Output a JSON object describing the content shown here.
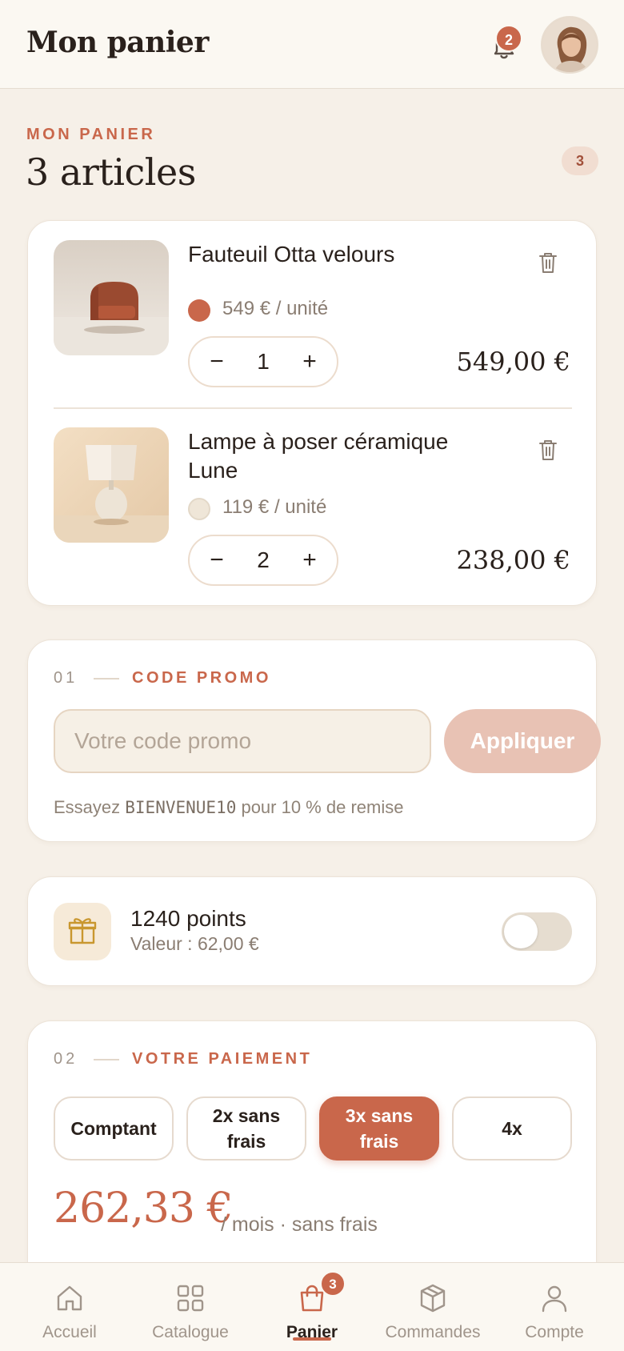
{
  "header": {
    "title": "Mon panier",
    "notifications_count": "2"
  },
  "summary": {
    "eyebrow": "MON PANIER",
    "title": "3 articles",
    "badge": "3"
  },
  "cart": {
    "items": [
      {
        "name": "Fauteuil Otta velours",
        "unit_price": "549 € / unité",
        "quantity": "1",
        "line_total": "549,00 €",
        "swatch_color": "#c9674b",
        "minus": "−",
        "plus": "+"
      },
      {
        "name": "Lampe à poser céramique Lune",
        "unit_price": "119 € / unité",
        "quantity": "2",
        "line_total": "238,00 €",
        "swatch_color": "#efe6d8",
        "minus": "−",
        "plus": "+"
      }
    ]
  },
  "promo": {
    "number": "01",
    "label": "CODE PROMO",
    "placeholder": "Votre code promo",
    "apply_label": "Appliquer",
    "hint_prefix": "Essayez ",
    "hint_code": "BIENVENUE10",
    "hint_suffix": " pour 10 % de remise"
  },
  "loyalty": {
    "title": "1240 points",
    "subtitle": "Valeur : 62,00 €",
    "enabled": false
  },
  "payment": {
    "number": "02",
    "label": "VOTRE PAIEMENT",
    "options": [
      "Comptant",
      "2x sans frais",
      "3x sans frais",
      "4x"
    ],
    "selected": "3x sans frais",
    "amount": "262,33 €",
    "amount_suffix": "/ mois · sans frais"
  },
  "nav": {
    "items": [
      {
        "label": "Accueil",
        "icon": "home-icon"
      },
      {
        "label": "Catalogue",
        "icon": "grid-icon"
      },
      {
        "label": "Panier",
        "icon": "shopping-bag-icon",
        "badge": "3",
        "active": true
      },
      {
        "label": "Commandes",
        "icon": "package-icon"
      },
      {
        "label": "Compte",
        "icon": "user-icon"
      }
    ]
  },
  "colors": {
    "accent": "#c9674b",
    "background": "#f6f0e8",
    "card": "#ffffff"
  }
}
